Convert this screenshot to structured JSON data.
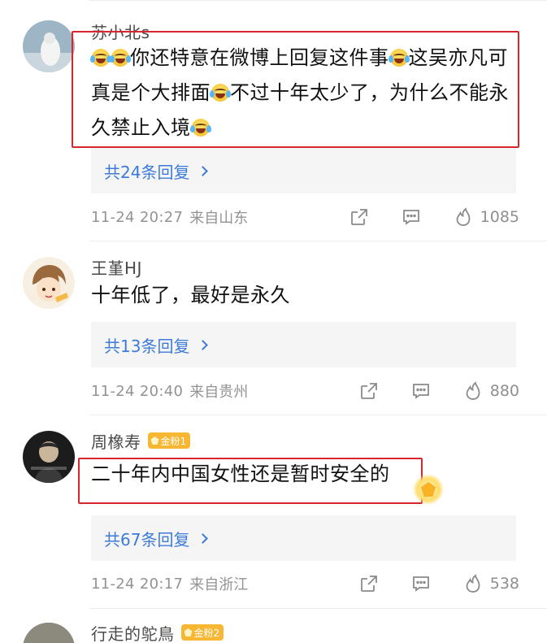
{
  "comments": [
    {
      "username": "苏小北s",
      "text": [
        "",
        "",
        "你还特意在微博上回复这件事",
        "这吴亦凡可真是个大排面",
        "不过十年太少了，为什么不能永久禁止入境",
        ""
      ],
      "replies_label": "共24条回复",
      "time": "11-24 20:27",
      "location": "来自山东",
      "likes": "1085"
    },
    {
      "username": "王堇HJ",
      "text": "十年低了，最好是永久",
      "replies_label": "共13条回复",
      "time": "11-24 20:40",
      "location": "来自贵州",
      "likes": "880"
    },
    {
      "username": "周橡寿",
      "badge": "金粉1",
      "text": "二十年内中国女性还是暂时安全的",
      "replies_label": "共67条回复",
      "time": "11-24 20:17",
      "location": "来自浙江",
      "likes": "538"
    },
    {
      "username": "行走的鸵鳥",
      "badge": "金粉2"
    }
  ],
  "colors": {
    "link_blue": "#3d7bd9",
    "highlight_red": "#d8262f",
    "badge_gold": "#f7b733",
    "meta_gray": "#939393"
  },
  "icons": [
    "share-icon",
    "comment-icon",
    "like-icon",
    "laughing-tears-emoji",
    "chevron-right-icon",
    "gem-icon"
  ]
}
